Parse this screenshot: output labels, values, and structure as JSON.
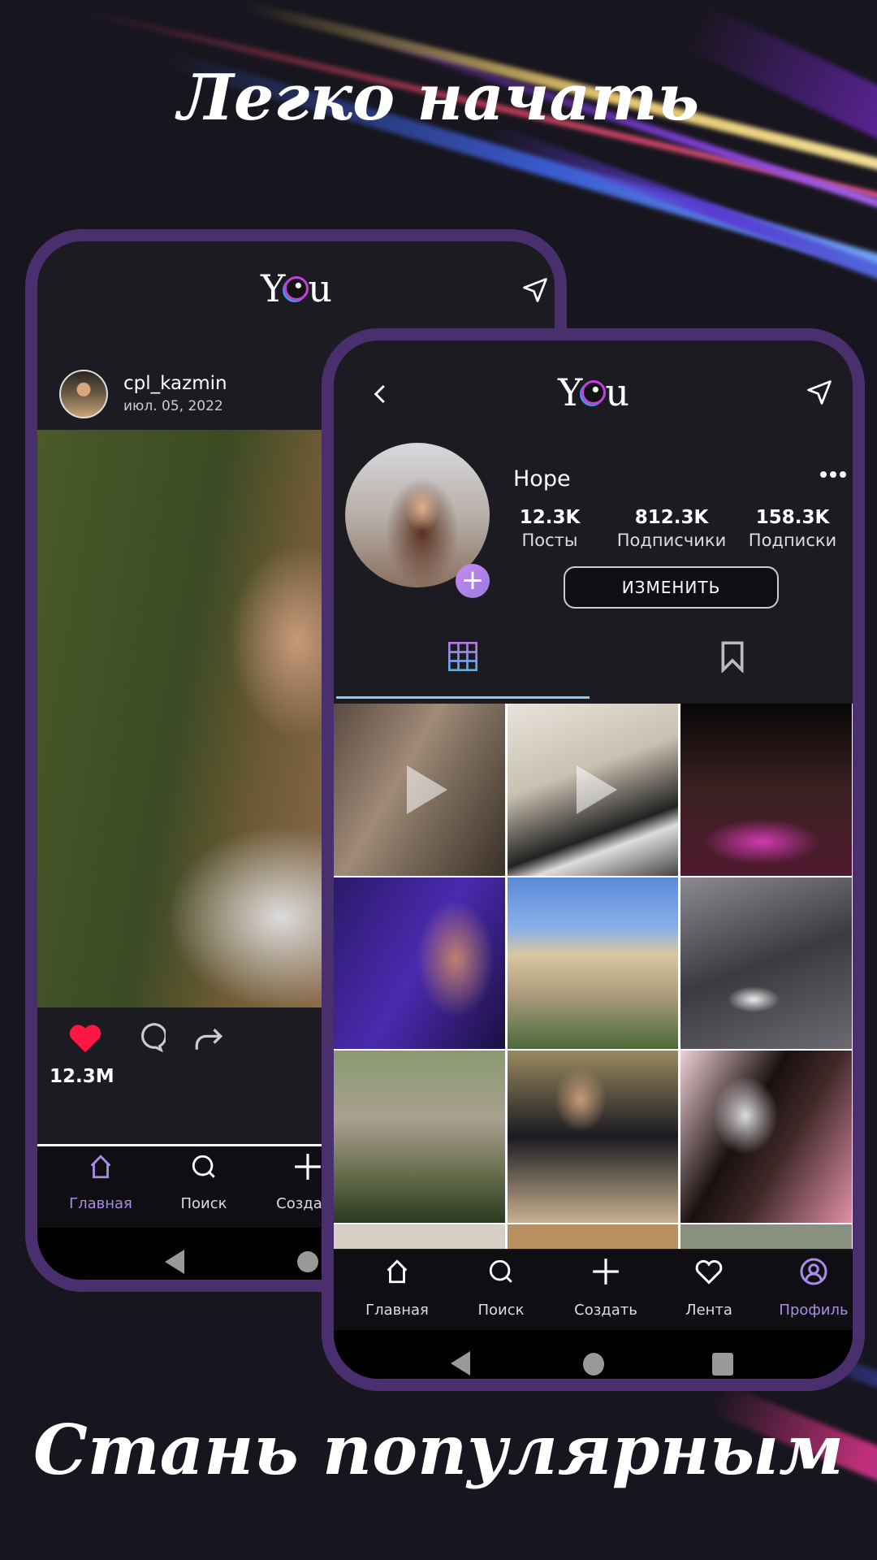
{
  "headline_top": "Легко начать",
  "headline_bottom": "Стань популярным",
  "colors": {
    "frame": "#4a2f6e",
    "screen": "#1c1b21",
    "accent": "#a98ce8",
    "like": "#ff1744"
  },
  "back_phone": {
    "logo": "You",
    "post": {
      "username": "cpl_kazmin",
      "date": "июл. 05, 2022",
      "likes": "12.3M",
      "liked": true
    },
    "nav": [
      {
        "label": "Главная",
        "icon": "home-icon",
        "active": true
      },
      {
        "label": "Поиск",
        "icon": "search-icon"
      },
      {
        "label": "Создать",
        "icon": "plus-icon"
      }
    ]
  },
  "front_phone": {
    "logo": "You",
    "profile": {
      "name": "Hope",
      "stats": [
        {
          "value": "12.3K",
          "label": "Посты"
        },
        {
          "value": "812.3K",
          "label": "Подписчики"
        },
        {
          "value": "158.3K",
          "label": "Подписки"
        }
      ],
      "edit_button": "ИЗМЕНИТЬ"
    },
    "tabs": [
      {
        "icon": "grid-icon",
        "active": true
      },
      {
        "icon": "bookmark-icon"
      }
    ],
    "nav": [
      {
        "label": "Главная",
        "icon": "home-icon"
      },
      {
        "label": "Поиск",
        "icon": "search-icon"
      },
      {
        "label": "Создать",
        "icon": "plus-icon"
      },
      {
        "label": "Лента",
        "icon": "heart-icon"
      },
      {
        "label": "Профиль",
        "icon": "profile-icon",
        "active": true
      }
    ]
  }
}
